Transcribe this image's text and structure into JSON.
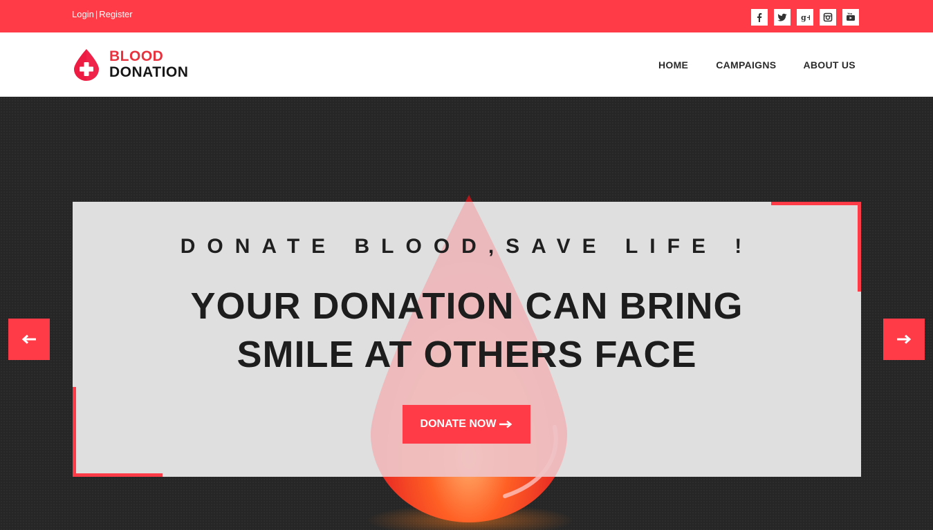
{
  "topbar": {
    "login_label": "Login",
    "separator": "|",
    "register_label": "Register",
    "socials": [
      "facebook-icon",
      "twitter-icon",
      "google-plus-icon",
      "instagram-icon",
      "youtube-icon"
    ]
  },
  "header": {
    "logo_line1": "BLOOD",
    "logo_line2": "DONATION",
    "nav": {
      "home": "HOME",
      "campaigns": "CAMPAIGNS",
      "about": "ABOUT US"
    }
  },
  "hero": {
    "tagline": "DONATE BLOOD,SAVE LIFE !",
    "headline_line1": "YOUR DONATION CAN BRING",
    "headline_line2": "SMILE AT OTHERS FACE",
    "cta_label": "DONATE NOW",
    "prev_icon": "arrow-left-icon",
    "next_icon": "arrow-right-icon"
  },
  "colors": {
    "accent": "#ff3b47",
    "dark_bg": "#262626",
    "text_dark": "#1d1d1d"
  }
}
